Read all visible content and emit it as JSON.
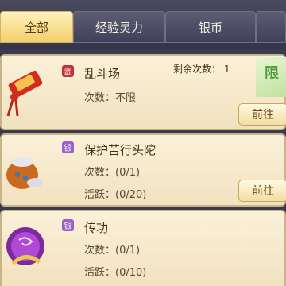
{
  "tabs": [
    {
      "label": "全部",
      "active": true
    },
    {
      "label": "经验灵力",
      "active": false
    },
    {
      "label": "银币",
      "active": false
    },
    {
      "label": "",
      "active": false
    }
  ],
  "activities": [
    {
      "badge": "武",
      "badge_color": "#c0333a",
      "icon": "red-scroll-pouch-icon",
      "title": "乱斗场",
      "times": "次数：不限",
      "remaining": "剩余次数： 1",
      "banner": "限",
      "button": "前往"
    },
    {
      "badge": "银",
      "badge_color": "#9a62c8",
      "icon": "treasure-bag-icon",
      "title": "保护苦行头陀",
      "times": "次数：(0/1)",
      "activity": "活跃：(0/20)",
      "button": "前往"
    },
    {
      "badge": "银",
      "badge_color": "#9a62c8",
      "icon": "purple-orb-icon",
      "title": "传功",
      "times": "次数：(0/1)",
      "activity": "活跃：(0/10)"
    }
  ],
  "colors": {
    "tab_active": "#f1cf6b",
    "card_bg": "#fbf1d9",
    "page_bg": "#3a3a4e"
  }
}
